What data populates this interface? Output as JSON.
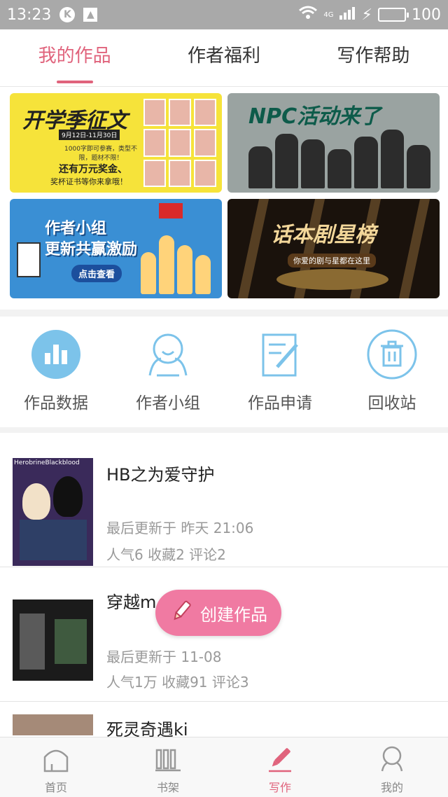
{
  "status_bar": {
    "time": "13:23",
    "badge": "K",
    "net": "4G",
    "battery": "100"
  },
  "tabs": [
    {
      "label": "我的作品",
      "active": true
    },
    {
      "label": "作者福利",
      "active": false
    },
    {
      "label": "写作帮助",
      "active": false
    }
  ],
  "banners": {
    "b1": {
      "title": "开学季征文",
      "date": "9月12日-11月30日",
      "text1": "1000字即可参赛，类型不限，题材不限！",
      "text2": "还有万元奖金、",
      "text3": "奖杯证书等你来拿哦！"
    },
    "b2": {
      "title": "NPC活动来了"
    },
    "b3": {
      "title_line1": "作者小组",
      "title_line2": "更新共赢激励",
      "button": "点击查看"
    },
    "b4": {
      "title": "话本剧星榜",
      "subtitle": "你爱的剧与星都在这里"
    }
  },
  "quick_actions": [
    {
      "label": "作品数据",
      "icon": "bar-chart-icon"
    },
    {
      "label": "作者小组",
      "icon": "group-icon"
    },
    {
      "label": "作品申请",
      "icon": "edit-document-icon"
    },
    {
      "label": "回收站",
      "icon": "trash-icon"
    }
  ],
  "works": [
    {
      "cover_text": "HerobrineBlackblood",
      "title": "HB之为爱守护",
      "updated": "最后更新于 昨天 21:06",
      "stats": "人气6 收藏2 评论2"
    },
    {
      "title": "穿越m",
      "updated": "最后更新于 11-08",
      "stats": "人气1万 收藏91 评论3"
    },
    {
      "title": "死灵奇遇ki"
    }
  ],
  "fab": {
    "label": "创建作品",
    "icon": "pencil-icon"
  },
  "bottom_nav": [
    {
      "label": "首页",
      "icon": "home-icon"
    },
    {
      "label": "书架",
      "icon": "bookshelf-icon"
    },
    {
      "label": "写作",
      "icon": "write-pen-icon",
      "active": true
    },
    {
      "label": "我的",
      "icon": "profile-icon"
    }
  ],
  "colors": {
    "accent": "#e0637c",
    "fab": "#f07aa2",
    "icon_blue": "#7cc3ea"
  }
}
